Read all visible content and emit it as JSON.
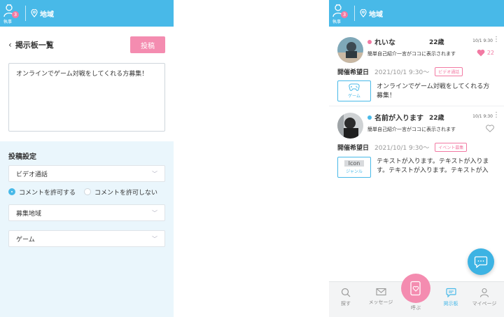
{
  "topbar": {
    "badge_count": "3",
    "logo_text": "執事",
    "area_label": "地域"
  },
  "compose": {
    "back_label": "掲示板一覧",
    "post_button": "投稿",
    "body_text": "オンラインでゲーム対戦をしてくれる方募集！",
    "settings_title": "投稿設定",
    "call_type_value": "ビデオ通話",
    "comment_allow": "コメントを許可する",
    "comment_deny": "コメントを許可しない",
    "region_placeholder": "募集地域",
    "genre_value": "ゲーム"
  },
  "posts": [
    {
      "name": "れいな",
      "age": "22歳",
      "date": "10/1 9:30",
      "intro": "簡単自己紹介一言がココに表示されます",
      "likes": "22",
      "hope_label": "開催希望日",
      "hope_date": "2021/10/1 9:30〜",
      "tag": "ビデオ通話",
      "genre": "ゲーム",
      "body": "オンラインでゲーム対戦をしてくれる方募集！"
    },
    {
      "name": "名前が入ります",
      "age": "22歳",
      "date": "10/1 9:30",
      "intro": "簡単自己紹介一言がココに表示されます",
      "likes": "",
      "hope_label": "開催希望日",
      "hope_date": "2021/10/1 9:30〜",
      "tag": "イベント募集",
      "genre_icon": "Icon",
      "genre": "ジャンル",
      "body": "テキストが入ります。テキストが入ります。テキストが入ります。テキストが入"
    }
  ],
  "nav": {
    "search": "探す",
    "message": "メッセージ",
    "call": "呼ぶ",
    "board": "掲示板",
    "mypage": "マイページ"
  },
  "colors": {
    "primary": "#48b9e8",
    "accent": "#f48cb0",
    "panel": "#eaf6fc"
  }
}
